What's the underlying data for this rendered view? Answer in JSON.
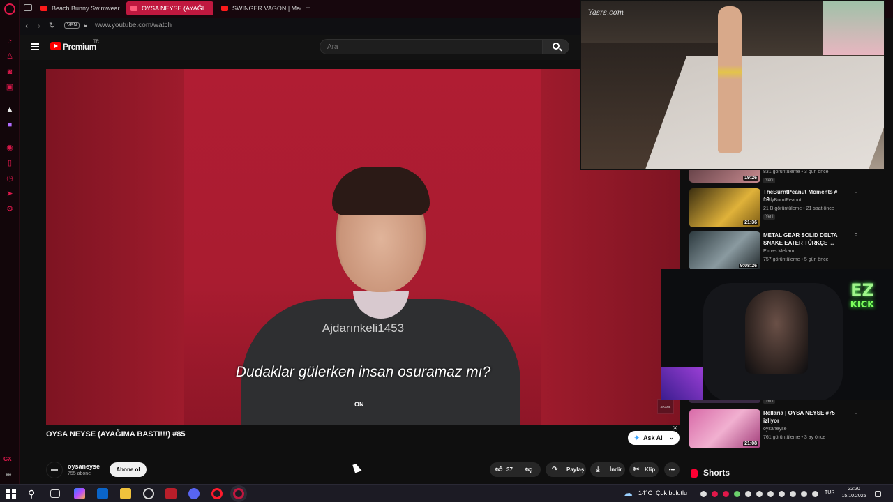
{
  "browser": {
    "tabs": [
      {
        "label": "Beach Bunny Swimwear F",
        "active": false
      },
      {
        "label": "OYSA NEYSE (AYAĞI",
        "active": true
      },
      {
        "label": "SWINGER VAGON | Mada",
        "active": false
      }
    ],
    "vpn_label": "VPN",
    "url": "www.youtube.com/watch",
    "gx_label": "GX"
  },
  "youtube": {
    "brand": "Premium",
    "country": "TR",
    "search_placeholder": "Ara"
  },
  "video": {
    "watermark": "Ajdarınkeli1453",
    "subtitle": "Dudaklar gülerken insan osuramaz mı?",
    "on_label": "ON",
    "title": "OYSA NEYSE (AYAĞIMA BASTI!!!) #85",
    "ask_ai": "Ask AI",
    "channel": "oysaneyse",
    "subscribers": "755 abone",
    "subscribe": "Abone ol",
    "likes": "37",
    "share": "Paylaş",
    "download": "İndir",
    "clip": "Klip"
  },
  "recommendations": [
    {
      "title": "",
      "channel": "",
      "meta": "831 görüntüleme • 3 gün önce",
      "badge": "Yeni",
      "duration": "19:26"
    },
    {
      "title": "TheBurntPeanut Moments # 19",
      "channel": "DailyBurntPeanut",
      "meta": "21 B görüntüleme • 21 saat önce",
      "badge": "Yeni",
      "duration": "21:36"
    },
    {
      "title": "METAL GEAR SOLID DELTA SNAKE EATER TÜRKÇE ...",
      "channel": "Elmas Mekanı",
      "meta": "757 görüntüleme • 5 gün önce",
      "badge": "Yeni",
      "duration": "9:08:26"
    },
    {
      "title": "",
      "channel": "",
      "meta": "",
      "badge": "Yeni",
      "duration": ""
    },
    {
      "title": "Rellaria | OYSA NEYSE #75 izliyor",
      "channel": "oysaneyse",
      "meta": "761 görüntüleme • 3 ay önce",
      "badge": "",
      "duration": "21:08"
    }
  ],
  "shorts_label": "Shorts",
  "overlays": {
    "runway_logo": "Yasrs.com",
    "ez": "EZ",
    "kick": "KICK"
  },
  "taskbar": {
    "temperature": "14°C",
    "weather": "Çok bulutlu",
    "language": "TUR",
    "time": "22:20",
    "date": "15.10.2025"
  },
  "colors": {
    "gx_accent": "#e0184a",
    "yt_red": "#ff0000",
    "video_bg": "#b01d33"
  }
}
